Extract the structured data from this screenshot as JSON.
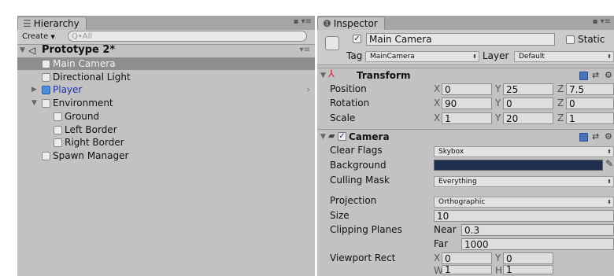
{
  "hierarchy": {
    "tab_title": "Hierarchy",
    "tab_icon": "list-icon",
    "tab_options": "☰",
    "create_label": "Create",
    "search_placeholder": "Q•All",
    "scene_name": "Prototype 2*",
    "items": [
      {
        "label": "Main Camera"
      },
      {
        "label": "Directional Light"
      },
      {
        "label": "Player"
      },
      {
        "label": "Environment"
      },
      {
        "label": "Ground"
      },
      {
        "label": "Left Border"
      },
      {
        "label": "Right Border"
      },
      {
        "label": "Spawn Manager"
      }
    ]
  },
  "inspector": {
    "tab_title": "Inspector",
    "object_name": "Main Camera",
    "static_label": "Static",
    "tag_label": "Tag",
    "tag_value": "MainCamera",
    "layer_label": "Layer",
    "layer_value": "Default",
    "transform": {
      "title": "Transform",
      "position_label": "Position",
      "rotation_label": "Rotation",
      "scale_label": "Scale",
      "position": {
        "x": "0",
        "y": "25",
        "z": "7.5"
      },
      "rotation": {
        "x": "90",
        "y": "0",
        "z": "0"
      },
      "scale": {
        "x": "1",
        "y": "20",
        "z": "1"
      }
    },
    "camera": {
      "title": "Camera",
      "clear_flags_label": "Clear Flags",
      "clear_flags_value": "Skybox",
      "background_label": "Background",
      "background_color": "#1f2d4e",
      "culling_mask_label": "Culling Mask",
      "culling_mask_value": "Everything",
      "projection_label": "Projection",
      "projection_value": "Orthographic",
      "size_label": "Size",
      "size_value": "10",
      "clipping_label": "Clipping Planes",
      "near_label": "Near",
      "near_value": "0.3",
      "far_label": "Far",
      "far_value": "1000",
      "viewport_label": "Viewport Rect",
      "viewport": {
        "x": "0",
        "y": "0",
        "w": "1",
        "h": "1"
      }
    },
    "axis": {
      "x": "X",
      "y": "Y",
      "z": "Z",
      "w": "W",
      "h": "H"
    }
  },
  "colors": {
    "panel_bg": "#c2c2c2",
    "selection": "#8e8e8e",
    "prefab_text": "#1a2fc0"
  }
}
